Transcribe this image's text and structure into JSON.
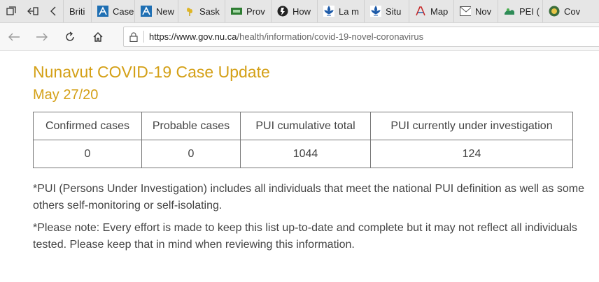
{
  "browser": {
    "tabs": [
      {
        "label": "Briti",
        "icon": "none"
      },
      {
        "label": "Case",
        "icon": "blue-a-icon"
      },
      {
        "label": "New",
        "icon": "blue-a-icon"
      },
      {
        "label": "Sask",
        "icon": "wheat-icon"
      },
      {
        "label": "Prov",
        "icon": "green-flag-icon"
      },
      {
        "label": "How",
        "icon": "globe-bolt-icon"
      },
      {
        "label": "La m",
        "icon": "fleur-de-lis-icon"
      },
      {
        "label": "Situ",
        "icon": "fleur-de-lis-icon"
      },
      {
        "label": "Map",
        "icon": "red-logo-icon"
      },
      {
        "label": "Nov",
        "icon": "envelope-icon"
      },
      {
        "label": "PEI (",
        "icon": "pei-icon"
      },
      {
        "label": "Cov",
        "icon": "crest-icon"
      }
    ],
    "url_domain": "https://www.gov.nu.ca",
    "url_path": "/health/information/covid-19-novel-coronavirus"
  },
  "page": {
    "title": "Nunavut COVID-19 Case Update",
    "date": "May 27/20",
    "table": {
      "headers": [
        "Confirmed cases",
        "Probable cases",
        "PUI cumulative total",
        "PUI currently under investigation"
      ],
      "rows": [
        [
          "0",
          "0",
          "1044",
          "124"
        ]
      ]
    },
    "note1": "*PUI (Persons Under Investigation) includes all individuals that meet the national PUI definition as well as some others self-monitoring or self-isolating.",
    "note2": "*Please note: Every effort is made to keep this list up-to-date and complete but it may not reflect all individuals tested. Please keep that in mind when reviewing this information."
  },
  "colors": {
    "heading": "#d4a017",
    "text": "#444444"
  }
}
